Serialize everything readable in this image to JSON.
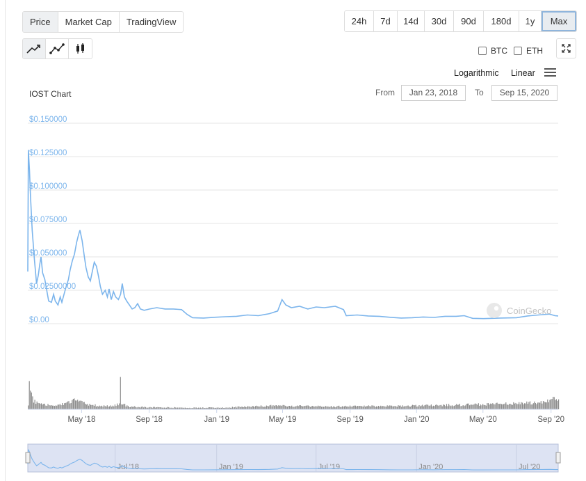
{
  "metric_tabs": [
    {
      "label": "Price",
      "active": true
    },
    {
      "label": "Market Cap",
      "active": false
    },
    {
      "label": "TradingView",
      "active": false
    }
  ],
  "range_tabs": [
    {
      "label": "24h"
    },
    {
      "label": "7d"
    },
    {
      "label": "14d"
    },
    {
      "label": "30d"
    },
    {
      "label": "90d"
    },
    {
      "label": "180d"
    },
    {
      "label": "1y"
    },
    {
      "label": "Max",
      "selected": true
    }
  ],
  "chart_type_icons": [
    "line-chart-icon",
    "line-points-chart-icon",
    "candlestick-chart-icon"
  ],
  "compare": {
    "btc_label": "BTC",
    "eth_label": "ETH"
  },
  "scale": {
    "logarithmic_label": "Logarithmic",
    "linear_label": "Linear"
  },
  "range_selector": {
    "from_label": "From",
    "from_value": "Jan 23, 2018",
    "to_label": "To",
    "to_value": "Sep 15, 2020"
  },
  "watermark": "CoinGecko",
  "colors": {
    "line": "#7cb5ec",
    "volume": "#8c8c8c",
    "navigator_bg": "#dde3f3"
  },
  "chart_data": {
    "type": "line",
    "title": "IOST Chart",
    "y_ticks": [
      "$0.150000",
      "$0.125000",
      "$0.100000",
      "$0.075000",
      "$0.050000",
      "$0.02500000",
      "$0.00"
    ],
    "ylim": [
      0,
      0.15
    ],
    "x_tick_labels": [
      "May '18",
      "Sep '18",
      "Jan '19",
      "May '19",
      "Sep '19",
      "Jan '20",
      "May '20",
      "Sep '20"
    ],
    "x_tick_days": [
      98,
      221,
      344,
      464,
      587,
      708,
      829,
      953
    ],
    "x_range_days": [
      0,
      966
    ],
    "navigator_tick_labels": [
      "Jul '18",
      "Jan '19",
      "Jul '19",
      "Jan '20",
      "Jul '20"
    ],
    "navigator_tick_days": [
      159,
      344,
      525,
      708,
      890
    ],
    "series": [
      {
        "values_day_price": [
          [
            0,
            0.039
          ],
          [
            1,
            0.13
          ],
          [
            3,
            0.115
          ],
          [
            5,
            0.095
          ],
          [
            8,
            0.07
          ],
          [
            12,
            0.048
          ],
          [
            16,
            0.03
          ],
          [
            19,
            0.036
          ],
          [
            22,
            0.045
          ],
          [
            24,
            0.05
          ],
          [
            27,
            0.038
          ],
          [
            31,
            0.033
          ],
          [
            34,
            0.026
          ],
          [
            38,
            0.017
          ],
          [
            43,
            0.016
          ],
          [
            47,
            0.022
          ],
          [
            50,
            0.017
          ],
          [
            55,
            0.014
          ],
          [
            59,
            0.02
          ],
          [
            62,
            0.016
          ],
          [
            66,
            0.022
          ],
          [
            70,
            0.028
          ],
          [
            74,
            0.033
          ],
          [
            77,
            0.04
          ],
          [
            81,
            0.047
          ],
          [
            85,
            0.052
          ],
          [
            89,
            0.061
          ],
          [
            92,
            0.066
          ],
          [
            95,
            0.07
          ],
          [
            99,
            0.062
          ],
          [
            103,
            0.05
          ],
          [
            106,
            0.042
          ],
          [
            110,
            0.035
          ],
          [
            114,
            0.032
          ],
          [
            118,
            0.04
          ],
          [
            121,
            0.046
          ],
          [
            125,
            0.043
          ],
          [
            129,
            0.035
          ],
          [
            132,
            0.028
          ],
          [
            136,
            0.022
          ],
          [
            141,
            0.025
          ],
          [
            145,
            0.02
          ],
          [
            148,
            0.026
          ],
          [
            152,
            0.018
          ],
          [
            156,
            0.024
          ],
          [
            160,
            0.02
          ],
          [
            165,
            0.018
          ],
          [
            169,
            0.022
          ],
          [
            172,
            0.03
          ],
          [
            176,
            0.02
          ],
          [
            180,
            0.017
          ],
          [
            185,
            0.014
          ],
          [
            190,
            0.011
          ],
          [
            195,
            0.012
          ],
          [
            200,
            0.015
          ],
          [
            205,
            0.011
          ],
          [
            212,
            0.01
          ],
          [
            222,
            0.011
          ],
          [
            235,
            0.012
          ],
          [
            250,
            0.011
          ],
          [
            265,
            0.011
          ],
          [
            280,
            0.0105
          ],
          [
            290,
            0.007
          ],
          [
            300,
            0.0045
          ],
          [
            320,
            0.0042
          ],
          [
            340,
            0.0048
          ],
          [
            360,
            0.0052
          ],
          [
            380,
            0.0055
          ],
          [
            400,
            0.0065
          ],
          [
            420,
            0.006
          ],
          [
            440,
            0.0075
          ],
          [
            455,
            0.0095
          ],
          [
            463,
            0.018
          ],
          [
            470,
            0.014
          ],
          [
            480,
            0.012
          ],
          [
            495,
            0.013
          ],
          [
            510,
            0.011
          ],
          [
            525,
            0.0125
          ],
          [
            540,
            0.012
          ],
          [
            560,
            0.013
          ],
          [
            575,
            0.0105
          ],
          [
            580,
            0.006
          ],
          [
            600,
            0.0065
          ],
          [
            620,
            0.0058
          ],
          [
            640,
            0.0055
          ],
          [
            660,
            0.0048
          ],
          [
            680,
            0.0042
          ],
          [
            700,
            0.0045
          ],
          [
            720,
            0.005
          ],
          [
            740,
            0.0047
          ],
          [
            760,
            0.0055
          ],
          [
            780,
            0.0055
          ],
          [
            795,
            0.006
          ],
          [
            810,
            0.004
          ],
          [
            830,
            0.0038
          ],
          [
            860,
            0.0042
          ],
          [
            890,
            0.0045
          ],
          [
            910,
            0.0058
          ],
          [
            930,
            0.0065
          ],
          [
            950,
            0.0072
          ],
          [
            960,
            0.006
          ],
          [
            966,
            0.0058
          ]
        ]
      }
    ],
    "volume_profile_day_relative": [
      [
        0,
        0.12
      ],
      [
        2,
        0.85
      ],
      [
        4,
        0.45
      ],
      [
        6,
        0.35
      ],
      [
        9,
        0.22
      ],
      [
        14,
        0.15
      ],
      [
        20,
        0.12
      ],
      [
        28,
        0.1
      ],
      [
        40,
        0.09
      ],
      [
        55,
        0.1
      ],
      [
        70,
        0.14
      ],
      [
        85,
        0.2
      ],
      [
        95,
        0.16
      ],
      [
        110,
        0.1
      ],
      [
        130,
        0.08
      ],
      [
        150,
        0.07
      ],
      [
        167,
        0.12
      ],
      [
        168,
        0.72
      ],
      [
        170,
        0.15
      ],
      [
        180,
        0.07
      ],
      [
        200,
        0.05
      ],
      [
        250,
        0.04
      ],
      [
        300,
        0.035
      ],
      [
        360,
        0.04
      ],
      [
        400,
        0.06
      ],
      [
        450,
        0.08
      ],
      [
        500,
        0.07
      ],
      [
        550,
        0.06
      ],
      [
        600,
        0.07
      ],
      [
        650,
        0.07
      ],
      [
        700,
        0.08
      ],
      [
        750,
        0.09
      ],
      [
        800,
        0.1
      ],
      [
        850,
        0.12
      ],
      [
        900,
        0.13
      ],
      [
        940,
        0.16
      ],
      [
        955,
        0.22
      ],
      [
        966,
        0.25
      ]
    ]
  }
}
